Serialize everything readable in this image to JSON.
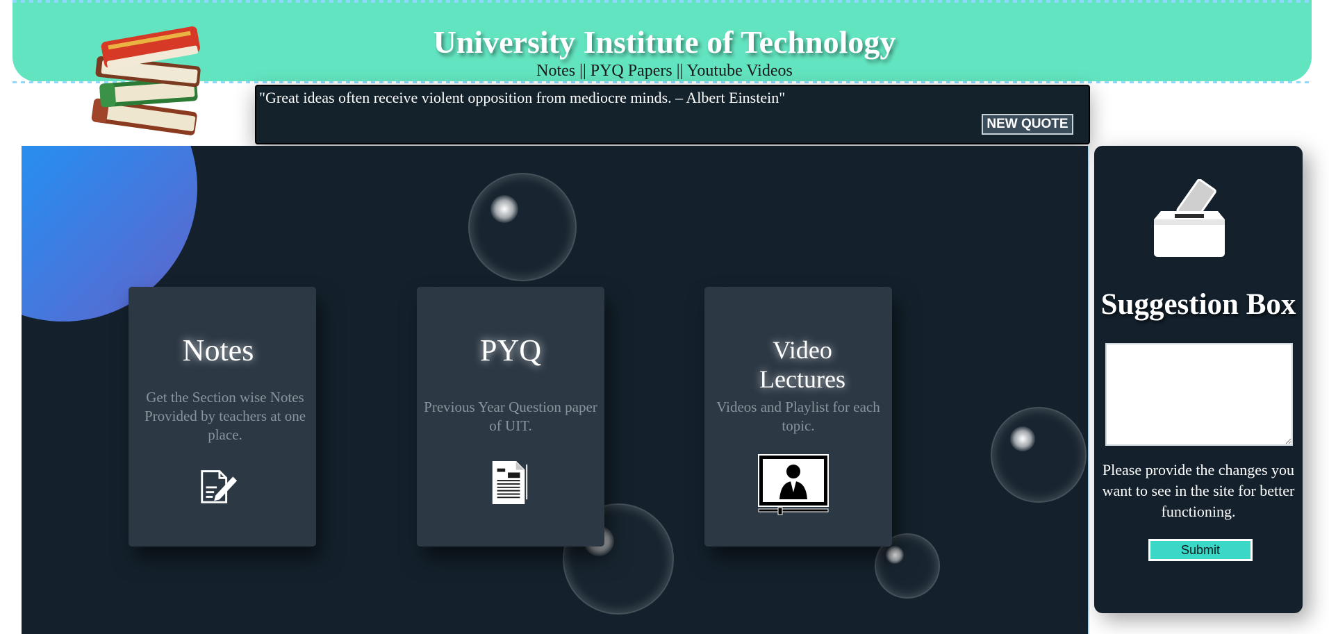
{
  "header": {
    "title": "University Institute of Technology",
    "nav": {
      "notes": "Notes",
      "sep1": " || ",
      "pyq": "PYQ Papers",
      "sep2": " || ",
      "videos": "Youtube Videos"
    },
    "logo_icon": "books-icon",
    "color": "#63e4c0"
  },
  "quote": {
    "text": "\"Great ideas often receive violent opposition from mediocre minds. – Albert Einstein\"",
    "button_label": "NEW QUOTE"
  },
  "cards": [
    {
      "title_line1": "Notes",
      "title_line2": "",
      "description": "Get the Section wise Notes Provided by teachers at one place.",
      "icon": "edit-document-icon"
    },
    {
      "title_line1": "PYQ",
      "title_line2": "",
      "description": "Previous Year Question paper of UIT.",
      "icon": "document-icon"
    },
    {
      "title_line1": "Video",
      "title_line2": "Lectures",
      "description": "Videos and Playlist for each topic.",
      "icon": "video-lecture-icon"
    }
  ],
  "suggestion": {
    "title": "Suggestion Box",
    "textarea_value": "",
    "note": "Please provide the changes you want to see in the site for better functioning.",
    "submit_label": "Submit",
    "icon": "ballot-box-icon"
  },
  "colors": {
    "stage": "#14212c",
    "card": "#2c3844",
    "accent": "#3bd8c8"
  }
}
